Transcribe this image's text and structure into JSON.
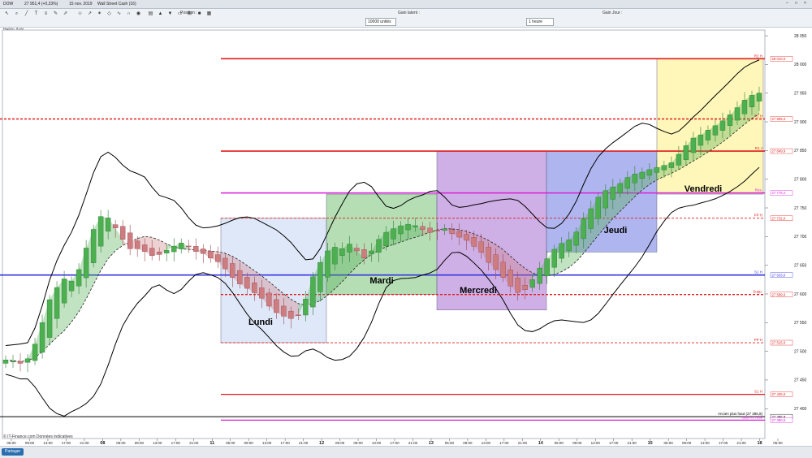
{
  "window": {
    "instrument": "DOW",
    "last": "27 951,4 (+0,23%)",
    "date": "15 nov. 2019",
    "name": "Wall Street Cash (16)",
    "position_label": "Position :",
    "gain_latent_label": "Gain latent :",
    "gain_jour_label": "Gain Jour :",
    "quantity": "10000 unités",
    "timeframe": "1 heure"
  },
  "chart_label": "Heikin-Ashi",
  "credit": "© IT-Finance.com  Données indicatives",
  "share_button": "Partager",
  "colors": {
    "up": "#4caf50",
    "down": "#cd7c80",
    "upper_line": "#000000",
    "red_level": "#e11d1d",
    "magenta_level": "#d81ed8",
    "blue_level": "#3535e0",
    "purple_level": "#6a2aa8",
    "green_level": "#2e9a2e"
  },
  "chart_data": {
    "type": "candlestick",
    "days": [
      {
        "name": "Lundi"
      },
      {
        "name": "Mardi"
      },
      {
        "name": "Mercredi"
      },
      {
        "name": "Jeudi"
      },
      {
        "name": "Vendredi"
      }
    ],
    "x_ticks": [
      "05:00",
      "09:00",
      "13:00",
      "17:00",
      "21:00",
      "08",
      "05:00",
      "09:00",
      "13:00",
      "17:00",
      "21:00",
      "11",
      "05:00",
      "09:00",
      "13:00",
      "17:00",
      "21:00",
      "12",
      "05:00",
      "09:00",
      "13:00",
      "17:00",
      "21:00",
      "13",
      "05:00",
      "09:00",
      "13:00",
      "17:00",
      "21:00",
      "14",
      "05:00",
      "09:00",
      "13:00",
      "17:00",
      "21:00",
      "15",
      "05:00",
      "09:00",
      "13:00",
      "17:00",
      "21:00",
      "18",
      "05:00"
    ],
    "y_ticks": [
      27400,
      27450,
      27500,
      27550,
      27600,
      27650,
      27700,
      27750,
      27800,
      27850,
      27900,
      27950,
      28000,
      28050
    ],
    "ylim": [
      27348,
      28060
    ],
    "close": [
      27485,
      27482,
      27478,
      27490,
      27520,
      27560,
      27600,
      27615,
      27630,
      27620,
      27650,
      27690,
      27720,
      27740,
      27730,
      27710,
      27690,
      27675,
      27680,
      27672,
      27665,
      27670,
      27678,
      27685,
      27690,
      27680,
      27672,
      27670,
      27660,
      27655,
      27640,
      27625,
      27615,
      27608,
      27600,
      27590,
      27575,
      27565,
      27560,
      27556,
      27565,
      27600,
      27640,
      27660,
      27680,
      27682,
      27678,
      27690,
      27670,
      27660,
      27680,
      27700,
      27710,
      27715,
      27720,
      27722,
      27718,
      27710,
      27706,
      27712,
      27714,
      27702,
      27698,
      27692,
      27680,
      27670,
      27650,
      27640,
      27625,
      27610,
      27600,
      27610,
      27630,
      27650,
      27665,
      27682,
      27690,
      27696,
      27712,
      27738,
      27752,
      27774,
      27782,
      27788,
      27794,
      27806,
      27810,
      27813,
      27818,
      27821,
      27825,
      27830,
      27848,
      27862,
      27875,
      27878,
      27888,
      27895,
      27904,
      27915,
      27928,
      27941,
      27948,
      27951
    ],
    "levels": [
      {
        "label": "R2 H",
        "value": "28 010,0",
        "color": "#e11d1d",
        "value_num": 28010
      },
      {
        "label": "R1 H",
        "value": "27 905,0",
        "color": "#e11d1d",
        "value_num": 27905
      },
      {
        "label": "R1 J",
        "value": "27 849,9",
        "color": "#e11d1d",
        "value_num": 27849
      },
      {
        "label": "Res.",
        "value": "27 776,2",
        "color": "#d81ed8",
        "value_num": 27776
      },
      {
        "label": "PP H",
        "value": "27 732,0",
        "color": "#e11d1d",
        "value_num": 27732
      },
      {
        "label": "S1 H",
        "value": "27 633,0",
        "color": "#3535e0",
        "value_num": 27633
      },
      {
        "label": "Supp.",
        "value": "27 599,0",
        "color": "#e11d1d",
        "value_num": 27599
      },
      {
        "label": "PP H",
        "value": "27 515,0",
        "color": "#e11d1d",
        "value_num": 27515
      },
      {
        "label": "S1 H",
        "value": "27 425,0",
        "color": "#e11d1d",
        "value_num": 27425
      },
      {
        "label": "Ancien plus haut (27 386,8)",
        "value": "27 386,8",
        "color": "#000000",
        "value_num": 27386
      },
      {
        "label": "Bas Ht. Risk",
        "value": "27 380,0",
        "color": "#d81ed8",
        "value_num": 27380
      },
      {
        "label": "Haut Ht. Risk",
        "value": "27 322,0",
        "color": "#6a2aa8",
        "value_num": 27322
      }
    ],
    "price_labels": [
      "28 032,4",
      "28 029,0",
      "28 012,1",
      "28 000,4",
      "27 991,6",
      "27 951,4",
      "27 950,0",
      "27 920,3",
      "27 899,4",
      "27 893,2",
      "27 873,0",
      "27 860,4",
      "27 848,0",
      "27 843,3",
      "27 832,7",
      "27 774,2",
      "27 756,0",
      "27 720,4",
      "27 702,0",
      "27 694,3",
      "27 652,0",
      "27 633,0",
      "27 599,0",
      "27 585,0",
      "27 515,0",
      "27 490,0",
      "27 425,0",
      "27 380,0",
      "27 355,0",
      "27 322,0",
      "27 302,0"
    ]
  }
}
